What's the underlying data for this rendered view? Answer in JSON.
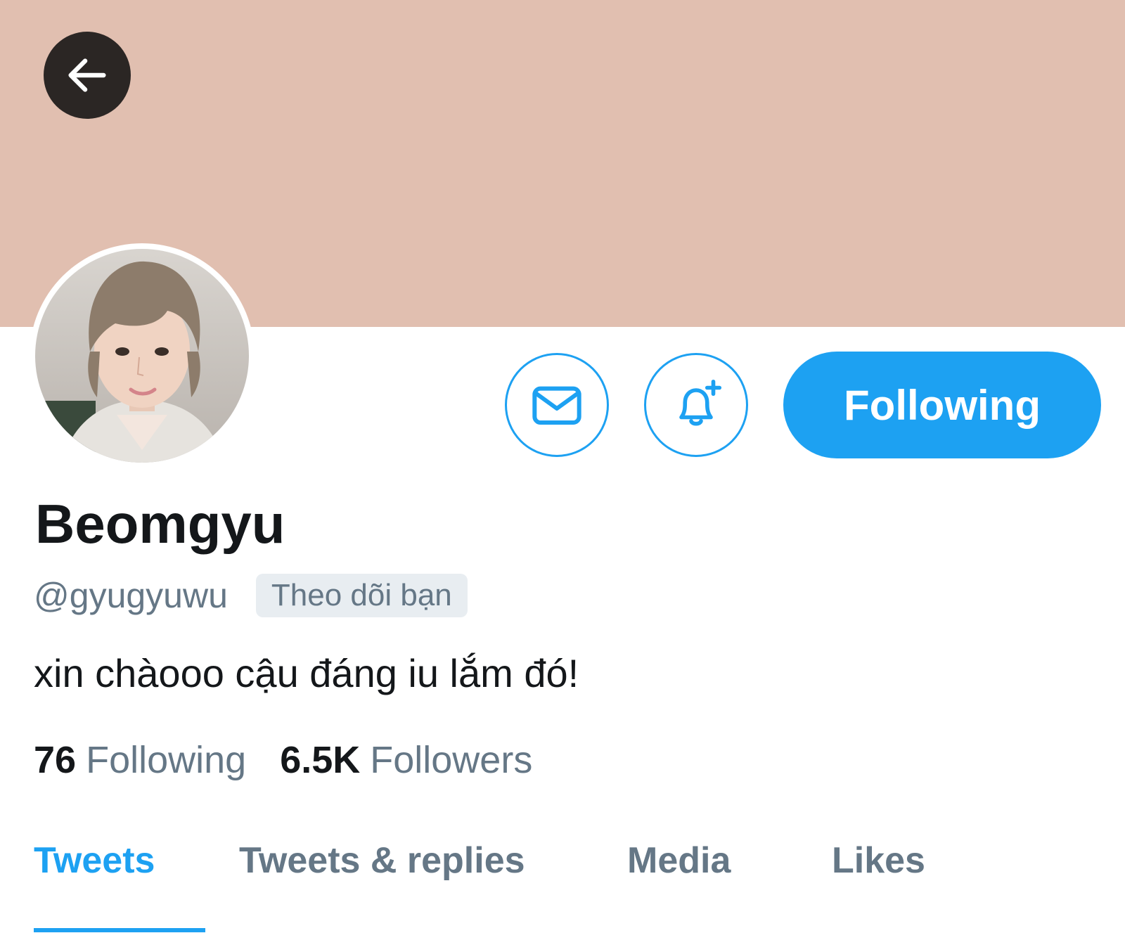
{
  "colors": {
    "accent": "#1da1f2",
    "banner": "#e1bfb0",
    "secondary_text": "#657786",
    "primary_text": "#14171a"
  },
  "header": {
    "back_icon": "arrow-left-icon"
  },
  "profile": {
    "avatar_icon": "profile-photo",
    "display_name": "Beomgyu",
    "handle": "@gyugyuwu",
    "follows_you_badge": "Theo dõi bạn",
    "bio": "xin chàooo cậu đáng iu lắm đó!"
  },
  "actions": {
    "message_icon": "envelope-icon",
    "notify_icon": "bell-plus-icon",
    "follow_label": "Following"
  },
  "stats": {
    "following_count": "76",
    "following_label": "Following",
    "followers_count": "6.5K",
    "followers_label": "Followers"
  },
  "tabs": [
    {
      "label": "Tweets",
      "active": true
    },
    {
      "label": "Tweets & replies",
      "active": false
    },
    {
      "label": "Media",
      "active": false
    },
    {
      "label": "Likes",
      "active": false
    }
  ]
}
